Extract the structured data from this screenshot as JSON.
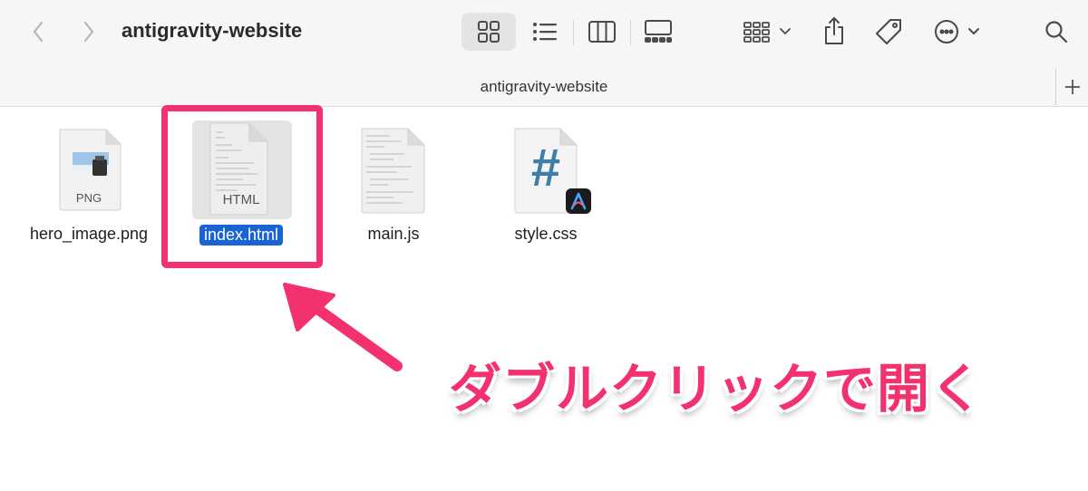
{
  "window": {
    "title": "antigravity-website"
  },
  "pathbar": {
    "title": "antigravity-website"
  },
  "files": [
    {
      "name": "hero_image.png",
      "badge": "PNG",
      "selected": false
    },
    {
      "name": "index.html",
      "badge": "HTML",
      "selected": true
    },
    {
      "name": "main.js",
      "badge": "",
      "selected": false
    },
    {
      "name": "style.css",
      "badge": "#",
      "selected": false
    }
  ],
  "annotation": {
    "text": "ダブルクリックで開く",
    "color": "#f4316f"
  },
  "colors": {
    "selection": "#1a63d4",
    "accent": "#f4316f",
    "toolbar_bg": "#f6f6f6"
  },
  "icons": [
    "back-icon",
    "forward-icon",
    "icon-view-icon",
    "list-view-icon",
    "column-view-icon",
    "gallery-view-icon",
    "group-icon",
    "share-icon",
    "tag-icon",
    "more-icon",
    "search-icon",
    "plus-icon"
  ]
}
